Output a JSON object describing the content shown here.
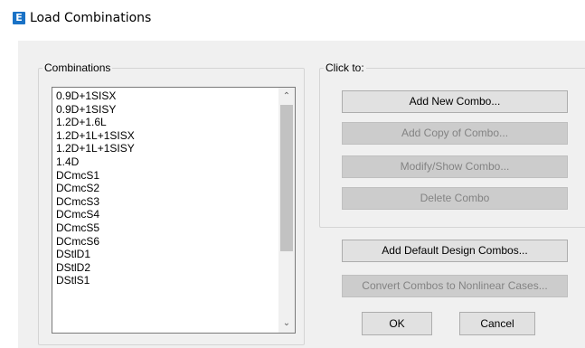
{
  "window": {
    "icon_letter": "E",
    "title": "Load Combinations"
  },
  "combinations": {
    "label": "Combinations",
    "items": [
      "0.9D+1SISX",
      "0.9D+1SISY",
      "1.2D+1.6L",
      "1.2D+1L+1SISX",
      "1.2D+1L+1SISY",
      "1.4D",
      "DCmcS1",
      "DCmcS2",
      "DCmcS3",
      "DCmcS4",
      "DCmcS5",
      "DCmcS6",
      "DStlD1",
      "DStlD2",
      "DStlS1"
    ],
    "scroll_up_glyph": "⌃",
    "scroll_down_glyph": "⌄"
  },
  "click_to": {
    "label": "Click to:",
    "add_new": "Add New Combo...",
    "add_copy": "Add Copy of Combo...",
    "modify_show": "Modify/Show Combo...",
    "delete": "Delete Combo"
  },
  "actions": {
    "add_default": "Add Default Design Combos...",
    "convert": "Convert Combos to Nonlinear Cases...",
    "ok": "OK",
    "cancel": "Cancel"
  },
  "colors": {
    "accent_icon": "#1a72c6",
    "dialog_bg": "#f0f0f0",
    "button_bg": "#e1e1e1",
    "button_disabled_bg": "#cccccc",
    "disabled_text": "#838383"
  }
}
